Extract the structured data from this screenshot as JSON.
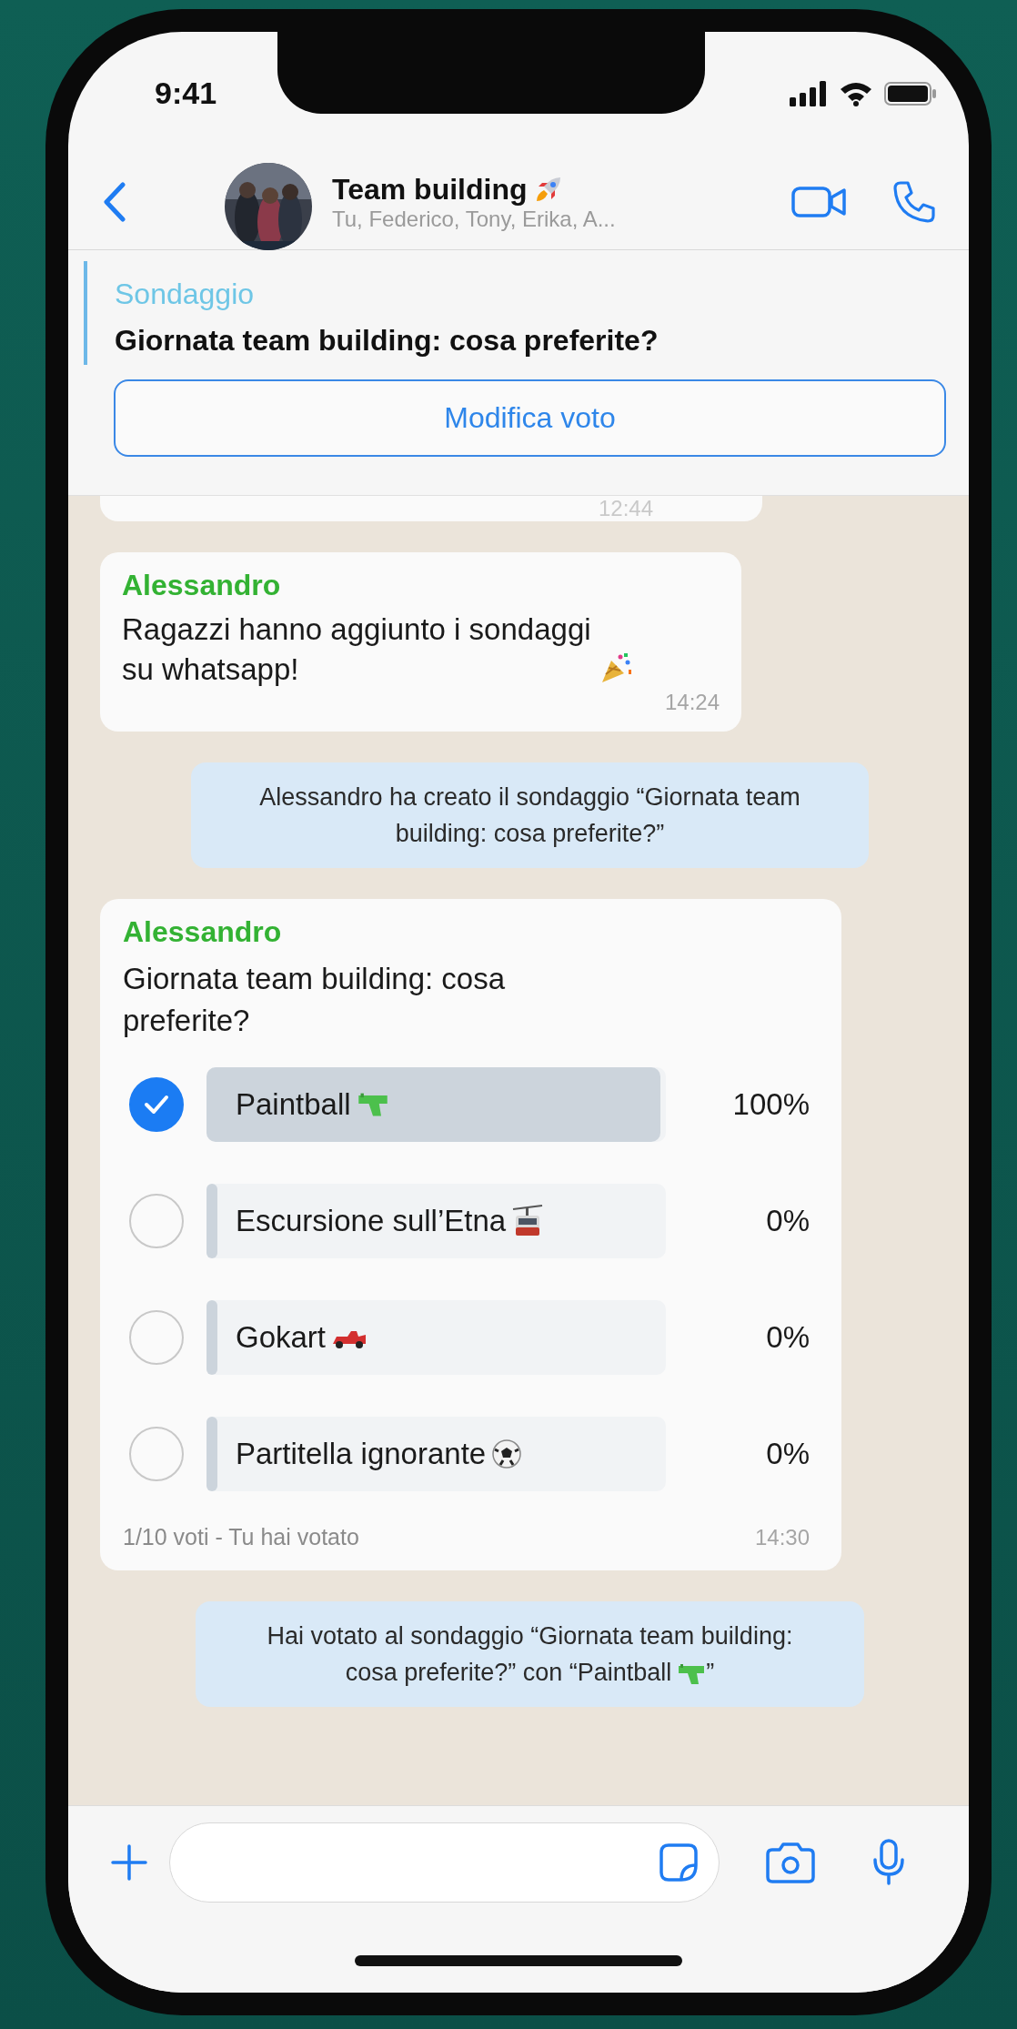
{
  "status_bar": {
    "time": "9:41"
  },
  "header": {
    "title": "Team building",
    "members": "Tu, Federico, Tony, Erika, A..."
  },
  "pinned_poll": {
    "label": "Sondaggio",
    "question": "Giornata team building: cosa preferite?",
    "button": "Modifica voto"
  },
  "messages": [
    {
      "kind": "cut",
      "time": "12:44"
    },
    {
      "kind": "text",
      "sender": "Alessandro",
      "text": "Ragazzi hanno aggiunto i sondaggi su whatsapp!",
      "time": "14:24"
    },
    {
      "kind": "system",
      "text": "Alessandro ha creato il sondaggio “Giornata team building: cosa preferite?”"
    },
    {
      "kind": "poll",
      "sender": "Alessandro",
      "question": "Giornata team building: cosa preferite?",
      "options": [
        {
          "label": "Paintball",
          "selected": true,
          "level": 1,
          "percent": "100%"
        },
        {
          "label": "Escursione sull’Etna",
          "selected": false,
          "level": 0,
          "percent": "0%"
        },
        {
          "label": "Gokart",
          "selected": false,
          "level": 0,
          "percent": "0%"
        },
        {
          "label": "Partitella ignorante",
          "selected": false,
          "level": 0,
          "percent": "0%"
        }
      ],
      "summary": "1/10 voti - Tu hai votato",
      "time": "14:30"
    },
    {
      "kind": "system",
      "text": "Hai votato al sondaggio “Giornata team building: cosa preferite?” con “Paintball",
      "text_end": "”"
    }
  ]
}
